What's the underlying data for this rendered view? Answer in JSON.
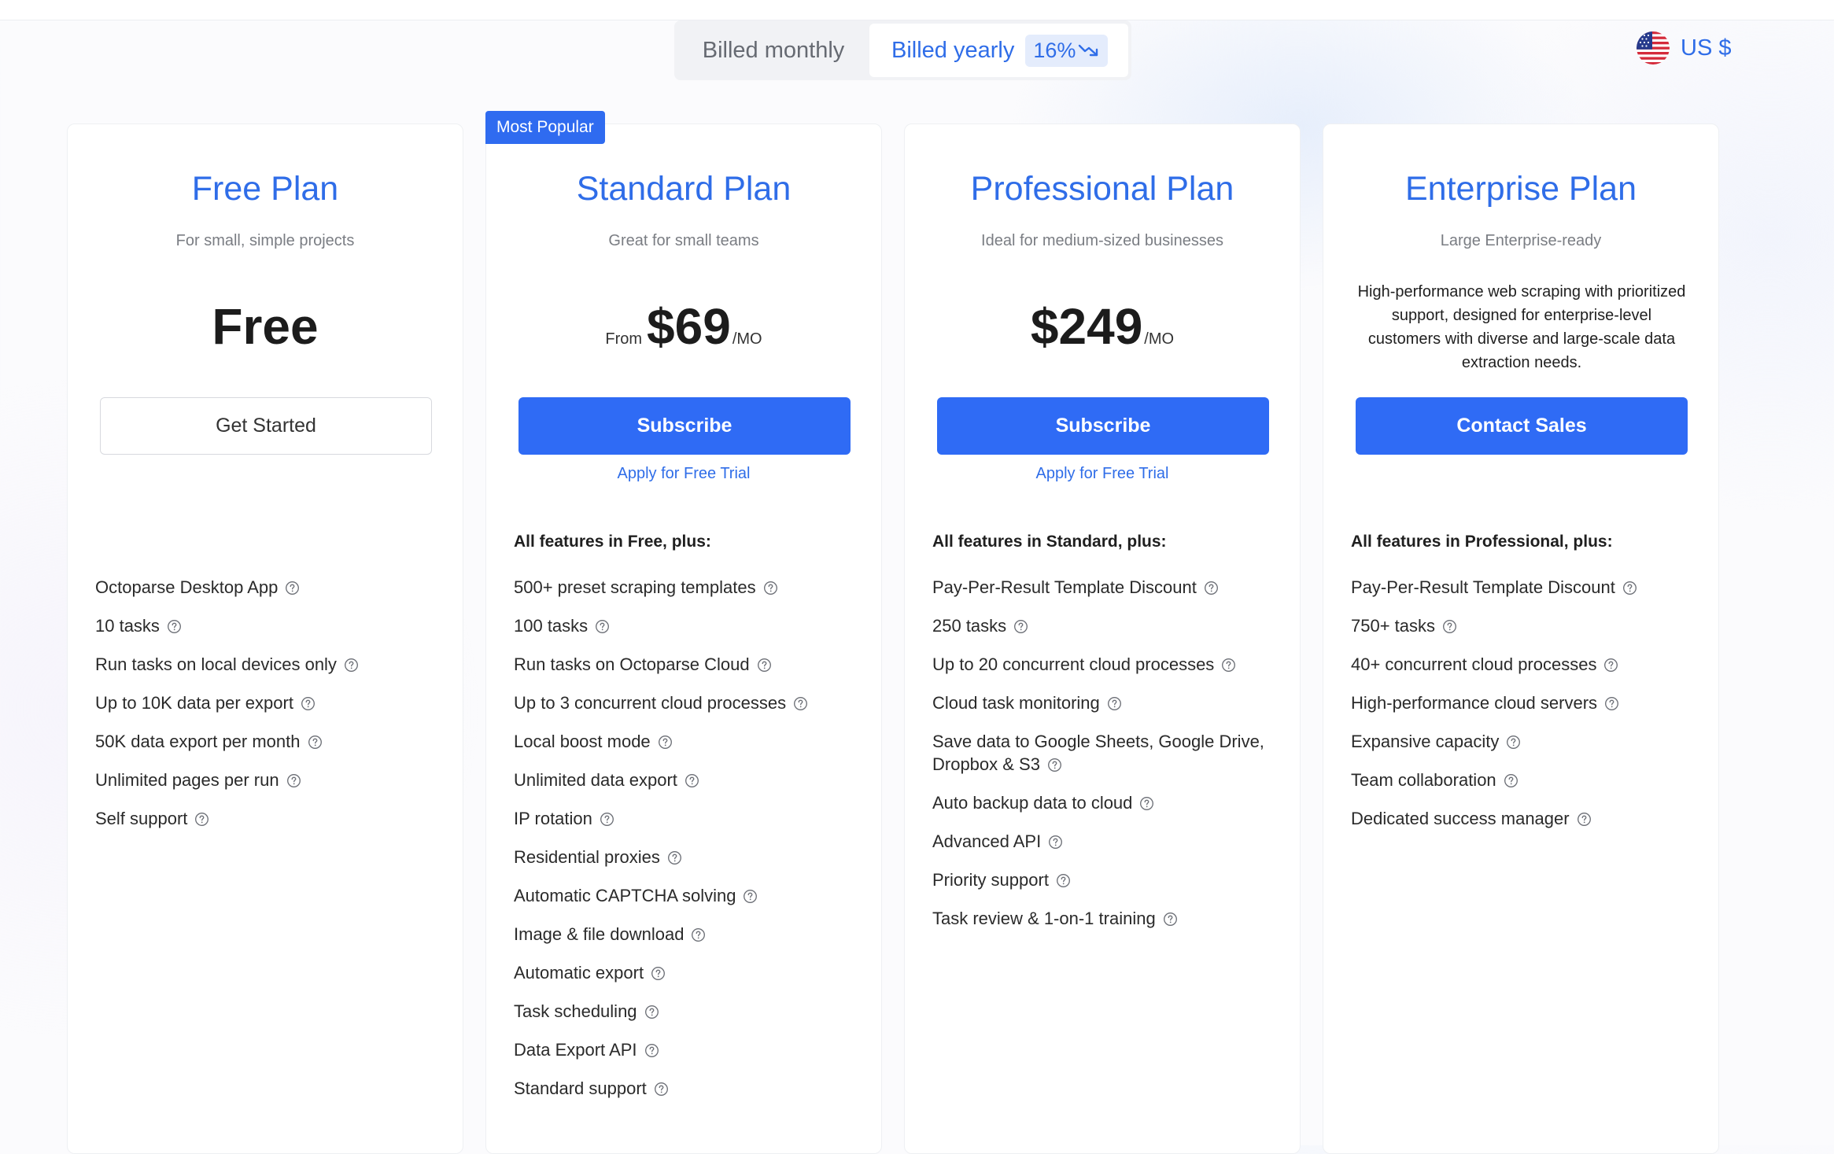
{
  "billing": {
    "monthly_label": "Billed monthly",
    "yearly_label": "Billed yearly",
    "discount": "16%",
    "discount_icon": "trend-down-icon",
    "selected": "yearly"
  },
  "currency": {
    "flag_icon": "us-flag-icon",
    "label": "US $"
  },
  "colors": {
    "accent": "#2f6de8",
    "primary_button": "#2f6bf5",
    "badge": "#2f6bf0"
  },
  "plans": [
    {
      "title": "Free Plan",
      "subtitle": "For small, simple projects",
      "price": "Free",
      "cta": "Get Started",
      "features": [
        "Octoparse Desktop App",
        "10 tasks",
        "Run tasks on local devices only",
        "Up to 10K data per export",
        "50K data export per month",
        "Unlimited pages per run",
        "Self support"
      ]
    },
    {
      "badge": "Most Popular",
      "title": "Standard Plan",
      "subtitle": "Great for small teams",
      "price_prefix": "From",
      "price": "$69",
      "price_unit": "/MO",
      "cta": "Subscribe",
      "trial_link": "Apply for Free Trial",
      "features_heading": "All features in Free, plus:",
      "features": [
        "500+ preset scraping templates",
        "100 tasks",
        "Run tasks on Octoparse Cloud",
        "Up to 3 concurrent cloud processes",
        "Local boost mode",
        "Unlimited data export",
        "IP rotation",
        "Residential proxies",
        "Automatic CAPTCHA solving",
        "Image & file download",
        "Automatic export",
        "Task scheduling",
        "Data Export API",
        "Standard support"
      ]
    },
    {
      "title": "Professional Plan",
      "subtitle": "Ideal for medium-sized businesses",
      "price": "$249",
      "price_unit": "/MO",
      "cta": "Subscribe",
      "trial_link": "Apply for Free Trial",
      "features_heading": "All features in Standard, plus:",
      "features": [
        "Pay-Per-Result Template Discount",
        "250 tasks",
        "Up to 20 concurrent cloud processes",
        "Cloud task monitoring",
        "Save data to Google Sheets, Google Drive, Dropbox & S3",
        "Auto backup data to cloud",
        "Advanced API",
        "Priority support",
        "Task review & 1-on-1 training"
      ]
    },
    {
      "title": "Enterprise Plan",
      "subtitle": "Large Enterprise-ready",
      "description": "High-performance web scraping with prioritized support, designed for enterprise-level customers with diverse and large-scale data extraction needs.",
      "cta": "Contact Sales",
      "features_heading": "All features in Professional, plus:",
      "features": [
        "Pay-Per-Result Template Discount",
        "750+ tasks",
        "40+ concurrent cloud processes",
        "High-performance cloud servers",
        "Expansive capacity",
        "Team collaboration",
        "Dedicated success manager"
      ]
    }
  ]
}
